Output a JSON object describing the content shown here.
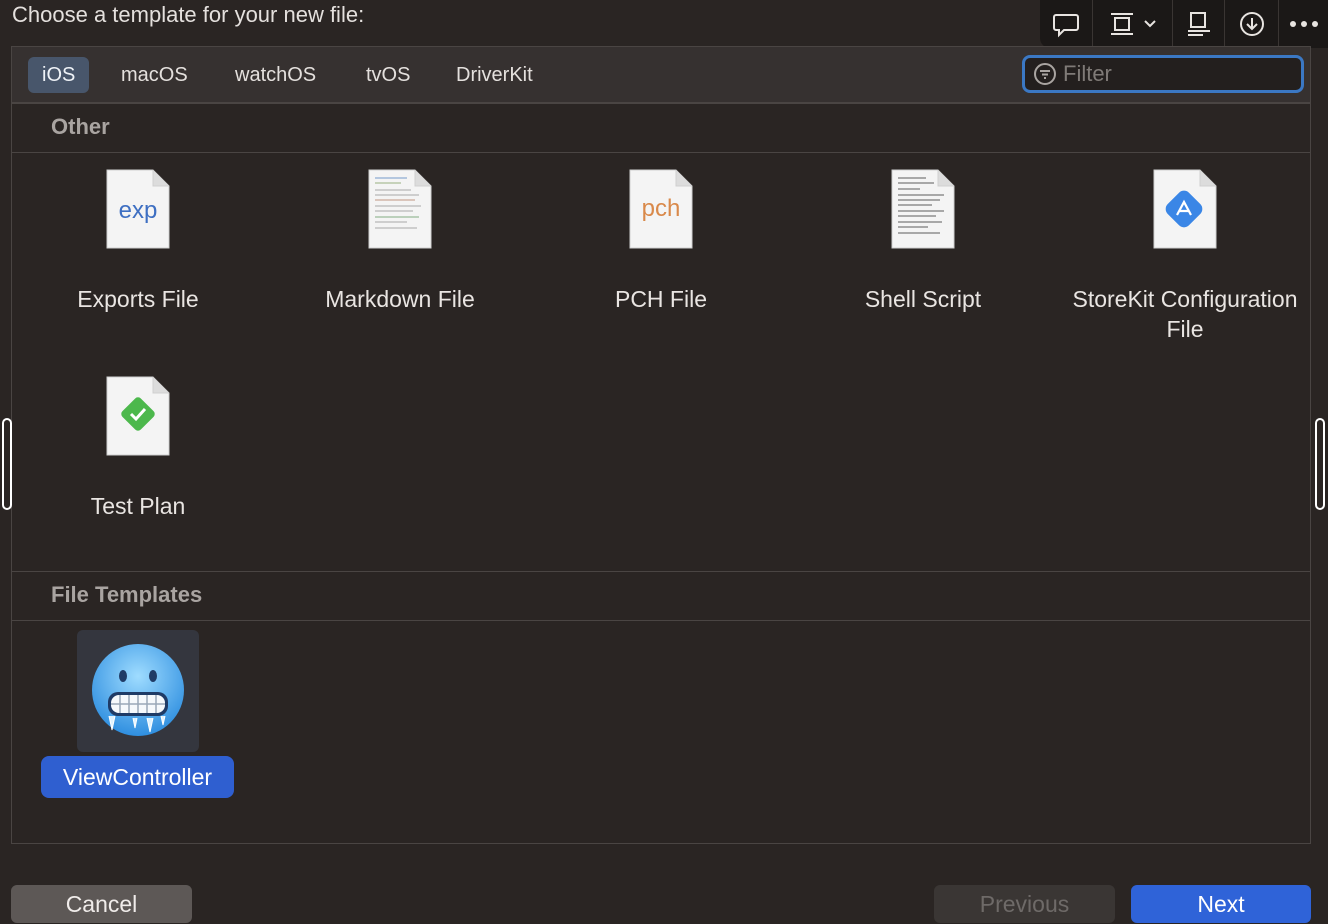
{
  "dialog": {
    "title": "Choose a template for your new file:"
  },
  "toolbar": {
    "icons": [
      "comment-icon",
      "frame-icon",
      "chevron-down-icon",
      "inspector-icon",
      "download-icon",
      "more-icon"
    ]
  },
  "tabs": [
    {
      "label": "iOS",
      "active": true
    },
    {
      "label": "macOS",
      "active": false
    },
    {
      "label": "watchOS",
      "active": false
    },
    {
      "label": "tvOS",
      "active": false
    },
    {
      "label": "DriverKit",
      "active": false
    }
  ],
  "filter": {
    "placeholder": "Filter",
    "value": ""
  },
  "sections": {
    "other": {
      "title": "Other",
      "items": [
        {
          "label": "Exports File",
          "icon": "exports-file-icon",
          "icon_text": "exp"
        },
        {
          "label": "Markdown File",
          "icon": "markdown-file-icon"
        },
        {
          "label": "PCH File",
          "icon": "pch-file-icon",
          "icon_text": "pch"
        },
        {
          "label": "Shell Script",
          "icon": "shell-script-icon"
        },
        {
          "label": "StoreKit Configuration File",
          "icon": "storekit-file-icon"
        },
        {
          "label": "Test Plan",
          "icon": "test-plan-icon"
        }
      ]
    },
    "file_templates": {
      "title": "File Templates",
      "items": [
        {
          "label": "ViewController",
          "icon": "cold-face-emoji-icon",
          "selected": true
        }
      ]
    }
  },
  "buttons": {
    "cancel": "Cancel",
    "previous": "Previous",
    "next": "Next"
  },
  "colors": {
    "accent": "#2f63d8",
    "selection": "#2f5fd0",
    "filter_focus": "#3b78c4"
  }
}
